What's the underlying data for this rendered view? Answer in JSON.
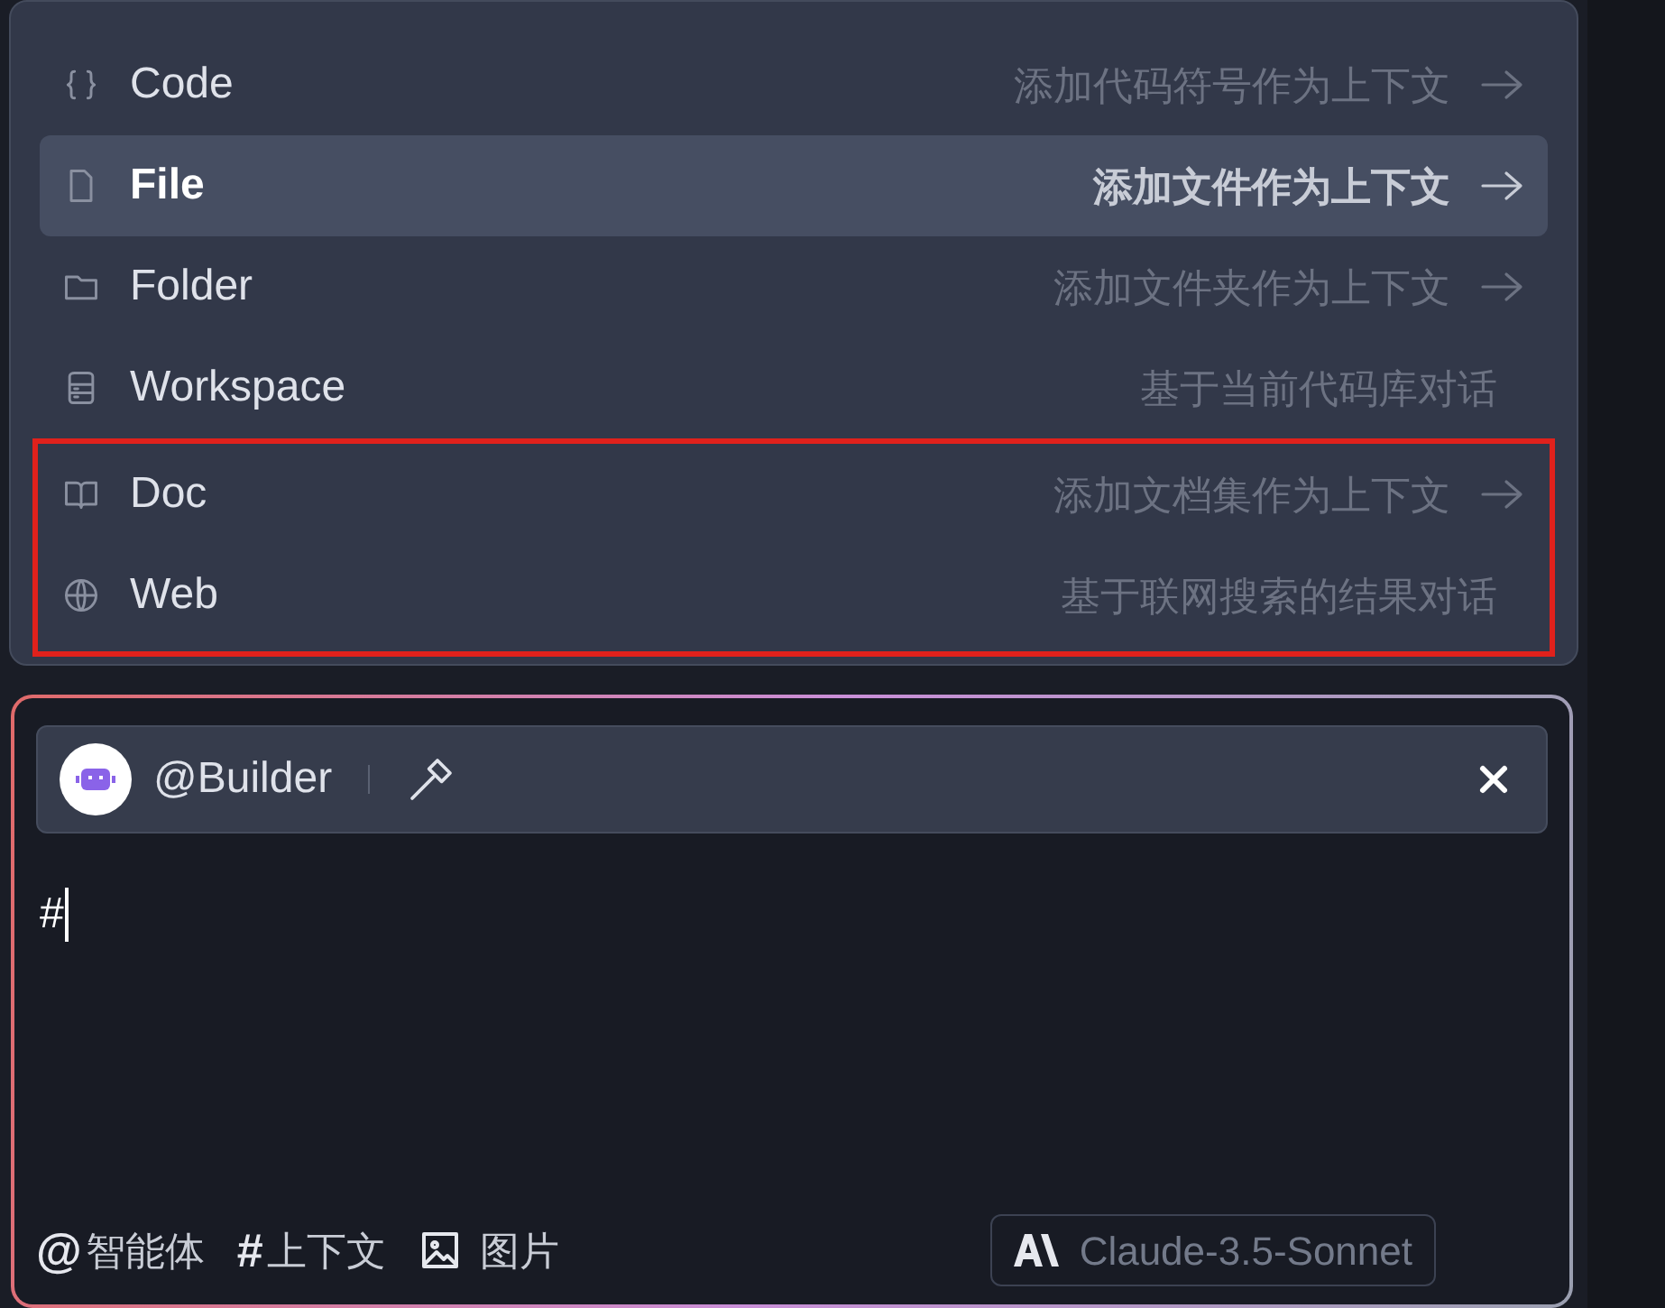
{
  "menu": {
    "items": [
      {
        "kind": "code",
        "label": "Code",
        "hint": "添加代码符号作为上下文",
        "arrow": true,
        "selected": false,
        "framed": false
      },
      {
        "kind": "file",
        "label": "File",
        "hint": "添加文件作为上下文",
        "arrow": true,
        "selected": true,
        "framed": false
      },
      {
        "kind": "folder",
        "label": "Folder",
        "hint": "添加文件夹作为上下文",
        "arrow": true,
        "selected": false,
        "framed": false
      },
      {
        "kind": "workspace",
        "label": "Workspace",
        "hint": "基于当前代码库对话",
        "arrow": false,
        "selected": false,
        "framed": false
      },
      {
        "kind": "doc",
        "label": "Doc",
        "hint": "添加文档集作为上下文",
        "arrow": true,
        "selected": false,
        "framed": true
      },
      {
        "kind": "web",
        "label": "Web",
        "hint": "基于联网搜索的结果对话",
        "arrow": false,
        "selected": false,
        "framed": true
      }
    ]
  },
  "composer": {
    "agent": {
      "name": "@Builder"
    },
    "value": "#",
    "tools": [
      {
        "kind": "symbol",
        "symbol": "@",
        "label": "智能体"
      },
      {
        "kind": "symbol",
        "symbol": "#",
        "label": "上下文"
      },
      {
        "kind": "image",
        "label": "图片"
      }
    ],
    "model": {
      "label": "Claude-3.5-Sonnet"
    }
  }
}
